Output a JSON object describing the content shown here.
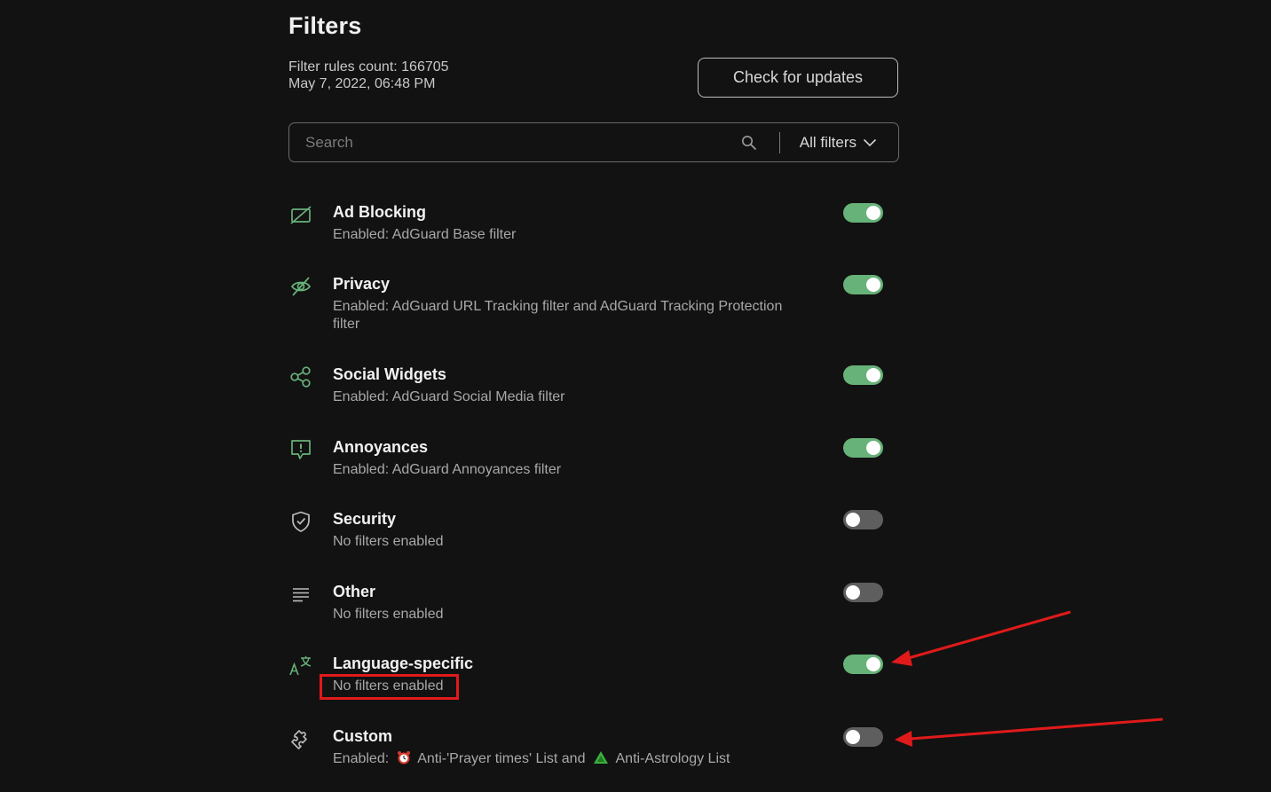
{
  "header": {
    "title": "Filters",
    "rules_count_text": "Filter rules count: 166705",
    "updated_text": "May 7, 2022, 06:48 PM",
    "check_updates_label": "Check for updates"
  },
  "search": {
    "placeholder": "Search",
    "filter_select_label": "All filters"
  },
  "groups": [
    {
      "title": "Ad Blocking",
      "description": "Enabled: AdGuard Base filter",
      "enabled": true,
      "icon": "ad-blocking-icon"
    },
    {
      "title": "Privacy",
      "description": "Enabled: AdGuard URL Tracking filter and AdGuard Tracking Protection filter",
      "enabled": true,
      "icon": "privacy-eye-off-icon"
    },
    {
      "title": "Social Widgets",
      "description": "Enabled: AdGuard Social Media filter",
      "enabled": true,
      "icon": "share-icon"
    },
    {
      "title": "Annoyances",
      "description": "Enabled: AdGuard Annoyances filter",
      "enabled": true,
      "icon": "alert-message-icon"
    },
    {
      "title": "Security",
      "description": "No filters enabled",
      "enabled": false,
      "icon": "shield-check-icon"
    },
    {
      "title": "Other",
      "description": "No filters enabled",
      "enabled": false,
      "icon": "lines-icon"
    },
    {
      "title": "Language-specific",
      "description": "No filters enabled",
      "enabled": true,
      "icon": "translate-icon"
    },
    {
      "title": "Custom",
      "description_prefix": "Enabled:",
      "description_item1": "Anti-'Prayer times' List and",
      "description_item2": "Anti-Astrology List",
      "enabled": false,
      "icon": "puzzle-icon"
    }
  ],
  "colors": {
    "background": "#121212",
    "accent_green": "#67b279",
    "toggle_off": "#5e5e5e",
    "annotation_red": "#e01a1a"
  }
}
